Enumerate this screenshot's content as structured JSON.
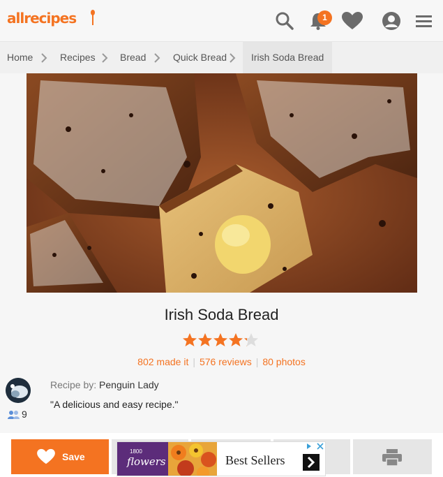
{
  "header": {
    "logo_text": "allrecipes",
    "notification_count": "1",
    "brand_color": "#f47321",
    "icons": [
      "search-icon",
      "bell-icon",
      "heart-icon",
      "user-icon",
      "menu-icon"
    ]
  },
  "breadcrumb": {
    "items": [
      "Home",
      "Recipes",
      "Bread",
      "Quick Bread",
      "Irish Soda Bread"
    ]
  },
  "recipe": {
    "title": "Irish Soda Bread",
    "rating": 4.5,
    "made_it": "802 made it",
    "reviews": "576 reviews",
    "photos": "80 photos",
    "recipe_by_label": "Recipe by:",
    "author": "Penguin Lady",
    "quote": "\"A delicious and easy recipe.\"",
    "fan_count": "9"
  },
  "actions": {
    "save_label": "Save"
  },
  "ad": {
    "brand_number": "1800",
    "brand_name": "flowers",
    "text": "Best Sellers"
  }
}
